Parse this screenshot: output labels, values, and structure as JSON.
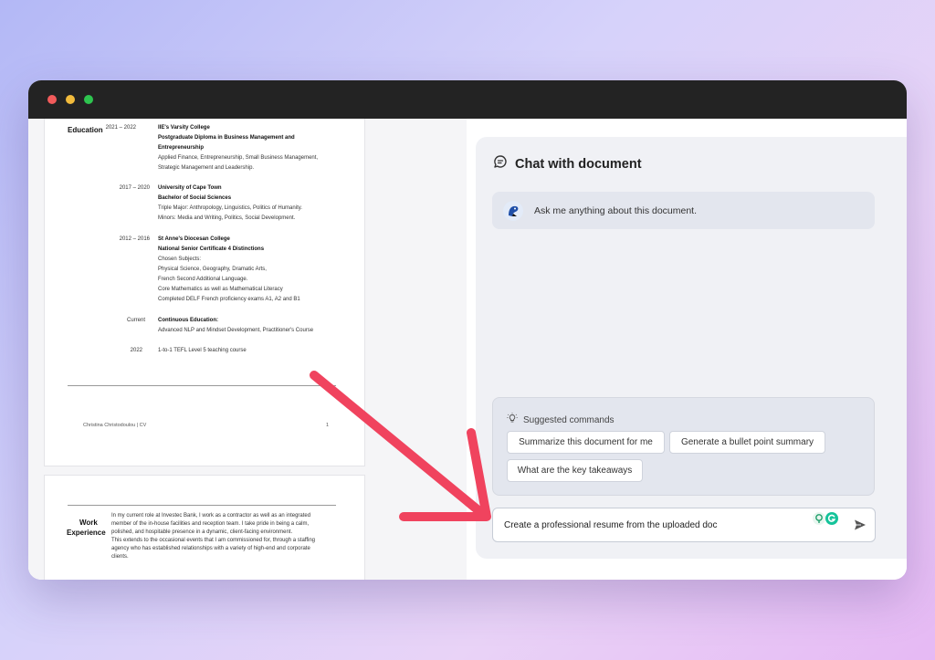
{
  "window": {
    "controls": [
      "close",
      "minimize",
      "maximize"
    ]
  },
  "cv": {
    "education_title": "Education",
    "entries": [
      {
        "years": "2021 – 2022",
        "lines": [
          {
            "text": "IIE's Varsity College",
            "bold": true
          },
          {
            "text": "Postgraduate Diploma in Business Management and",
            "bold": true
          },
          {
            "text": "Entrepreneurship",
            "bold": true
          },
          {
            "text": "Applied Finance, Entrepreneurship, Small Business Management,",
            "bold": false
          },
          {
            "text": "Strategic Management and Leadership.",
            "bold": false
          }
        ]
      },
      {
        "years": "2017 – 2020",
        "lines": [
          {
            "text": "University of Cape Town",
            "bold": true
          },
          {
            "text": "Bachelor of Social Sciences",
            "bold": true
          },
          {
            "text": "Triple Major: Anthropology, Linguistics, Politics of Humanity.",
            "bold": false
          },
          {
            "text": "Minors: Media and Writing, Politics, Social Development.",
            "bold": false
          }
        ]
      },
      {
        "years": "2012 – 2016",
        "lines": [
          {
            "text": "St Anne's Diocesan College",
            "bold": true
          },
          {
            "text": "National Senior Certificate 4 Distinctions",
            "bold": true
          },
          {
            "text": "Chosen Subjects:",
            "bold": false
          },
          {
            "text": "Physical Science, Geography, Dramatic Arts,",
            "bold": false
          },
          {
            "text": "French Second Additional Language.",
            "bold": false
          },
          {
            "text": "Core Mathematics as well as Mathematical Literacy",
            "bold": false
          },
          {
            "text": "Completed DELF French proficiency exams A1, A2 and B1",
            "bold": false
          }
        ]
      },
      {
        "years": "Current",
        "lines": [
          {
            "text": "Continuous Education:",
            "bold": true
          },
          {
            "text": "Advanced NLP and Mindset Development, Practitioner's Course",
            "bold": false
          }
        ]
      },
      {
        "years": "2022",
        "lines": [
          {
            "text": "1-to-1 TEFL Level 5 teaching course",
            "bold": false
          }
        ]
      }
    ],
    "footer_name": "Christina Christodoulou  |  CV",
    "footer_page": "1",
    "work_title_1": "Work",
    "work_title_2": "Experience",
    "work_lines": [
      "In my current role at Investec Bank, I work as a contractor as well as an integrated",
      "member of the in-house facilities and reception team. I take pride in being a calm,",
      "polished, and hospitable presence in a dynamic, client-facing environment.",
      "This extends to the occasional events that I am commissioned for, through a staffing",
      "agency who has established relationships with a variety of high-end and corporate",
      "clients."
    ]
  },
  "chat": {
    "title": "Chat with document",
    "intro": "Ask me anything about this document.",
    "suggested_label": "Suggested commands",
    "chips": [
      "Summarize this document for me",
      "Generate a bullet point summary",
      "What are the key takeaways"
    ],
    "input_value": "Create a professional resume from the uploaded doc"
  },
  "colors": {
    "arrow": "#f0435e",
    "titlebar": "#232323",
    "chat_bg": "#f0f1f5",
    "grammarly": "#15c39a"
  }
}
